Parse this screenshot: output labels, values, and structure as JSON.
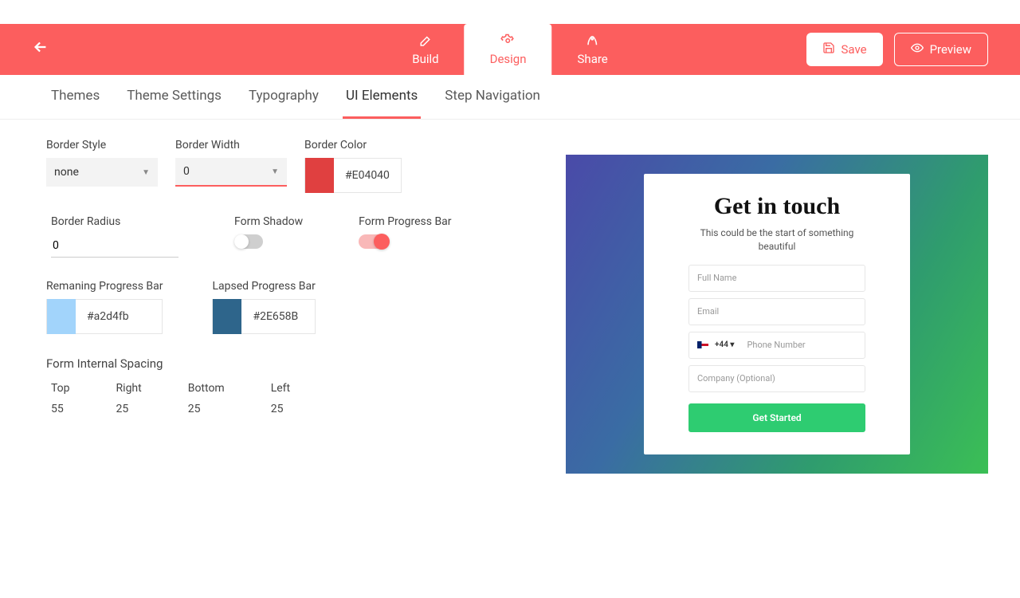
{
  "header": {
    "tabs": [
      {
        "id": "build",
        "label": "Build"
      },
      {
        "id": "design",
        "label": "Design"
      },
      {
        "id": "share",
        "label": "Share"
      }
    ],
    "save_label": "Save",
    "preview_label": "Preview"
  },
  "subnav": {
    "items": [
      "Themes",
      "Theme Settings",
      "Typography",
      "UI Elements",
      "Step Navigation"
    ],
    "active_index": 3
  },
  "panel": {
    "border_style": {
      "label": "Border Style",
      "value": "none"
    },
    "border_width": {
      "label": "Border Width",
      "value": "0"
    },
    "border_color": {
      "label": "Border Color",
      "value": "#E04040",
      "swatch": "#E04040"
    },
    "border_radius": {
      "label": "Border Radius",
      "value": "0"
    },
    "form_shadow": {
      "label": "Form Shadow",
      "on": false
    },
    "form_progress": {
      "label": "Form Progress Bar",
      "on": true
    },
    "remaining_bar": {
      "label": "Remaning Progress Bar",
      "value": "#a2d4fb",
      "swatch": "#a2d4fb"
    },
    "lapsed_bar": {
      "label": "Lapsed Progress Bar",
      "value": "#2E658B",
      "swatch": "#2E658B"
    },
    "spacing": {
      "title": "Form Internal Spacing",
      "cols": [
        {
          "label": "Top",
          "value": "55"
        },
        {
          "label": "Right",
          "value": "25"
        },
        {
          "label": "Bottom",
          "value": "25"
        },
        {
          "label": "Left",
          "value": "25"
        }
      ]
    }
  },
  "preview_form": {
    "title": "Get in touch",
    "subtitle": "This could be the start of something beautiful",
    "fields": {
      "full_name": "Full Name",
      "email": "Email",
      "dial_code": "+44",
      "phone": "Phone Number",
      "company": "Company (Optional)"
    },
    "cta": "Get Started"
  }
}
